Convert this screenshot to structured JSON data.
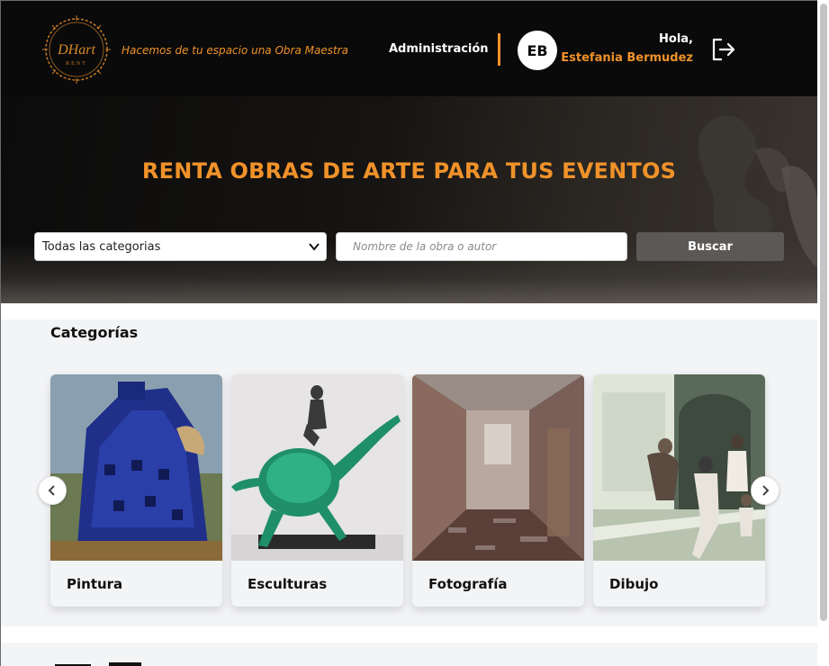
{
  "header": {
    "logo_text": "DHart",
    "logo_subtext": "RENT",
    "tagline": "Hacemos de tu espacio una Obra Maestra",
    "admin_label": "Administración",
    "avatar_initials": "EB",
    "greeting": "Hola,",
    "user_name": "Estefania Bermudez",
    "logout_icon": "logout-icon"
  },
  "hero": {
    "title": "RENTA OBRAS DE ARTE PARA TUS EVENTOS",
    "category_select": {
      "selected": "Todas las categorias"
    },
    "search": {
      "placeholder": "Nombre de la obra o autor"
    },
    "search_button": "Buscar"
  },
  "categories": {
    "heading": "Categorías",
    "items": [
      {
        "label": "Pintura"
      },
      {
        "label": "Esculturas"
      },
      {
        "label": "Fotografía"
      },
      {
        "label": "Dibujo"
      }
    ],
    "prev_icon": "chevron-left-icon",
    "next_icon": "chevron-right-icon"
  },
  "colors": {
    "accent": "#f0922a",
    "header_bg": "#0a0a0a",
    "section_bg": "#f3f4f6",
    "button_bg": "#5b5856"
  }
}
